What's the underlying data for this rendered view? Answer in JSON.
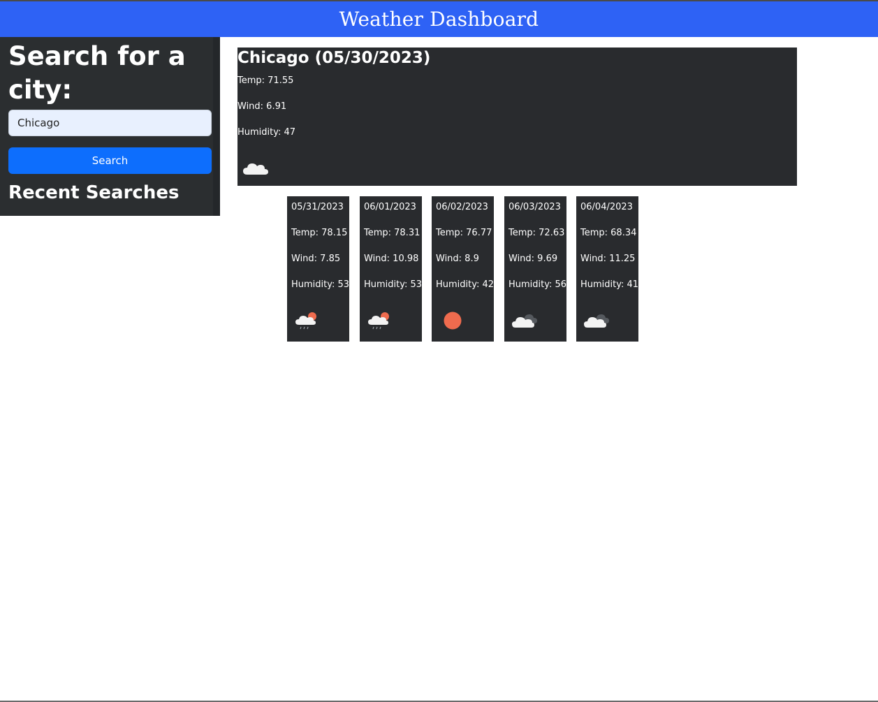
{
  "header": {
    "title": "Weather Dashboard"
  },
  "sidebar": {
    "heading": "Search for a city:",
    "search_input": {
      "value": "Chicago",
      "placeholder": ""
    },
    "search_button_label": "Search",
    "recent_heading": "Recent Searches"
  },
  "current": {
    "title": "Chicago (05/30/2023)",
    "temp": "Temp: 71.55",
    "wind": "Wind: 6.91",
    "humidity": "Humidity: 47",
    "icon": "cloud-icon"
  },
  "forecast": [
    {
      "date": "05/31/2023",
      "temp": "Temp: 78.15",
      "wind": "Wind: 7.85",
      "humidity": "Humidity: 53",
      "icon": "sun-rain-cloud-icon"
    },
    {
      "date": "06/01/2023",
      "temp": "Temp: 78.31",
      "wind": "Wind: 10.98",
      "humidity": "Humidity: 53",
      "icon": "sun-rain-cloud-icon"
    },
    {
      "date": "06/02/2023",
      "temp": "Temp: 76.77",
      "wind": "Wind: 8.9",
      "humidity": "Humidity: 42",
      "icon": "sun-icon"
    },
    {
      "date": "06/03/2023",
      "temp": "Temp: 72.63",
      "wind": "Wind: 9.69",
      "humidity": "Humidity: 56",
      "icon": "broken-clouds-icon"
    },
    {
      "date": "06/04/2023",
      "temp": "Temp: 68.34",
      "wind": "Wind: 11.25",
      "humidity": "Humidity: 41",
      "icon": "broken-clouds-icon"
    }
  ],
  "colors": {
    "header_bg": "#2e62f5",
    "card_bg": "#292b2e",
    "button_bg": "#0d6efd",
    "sun": "#ef6b4e"
  }
}
